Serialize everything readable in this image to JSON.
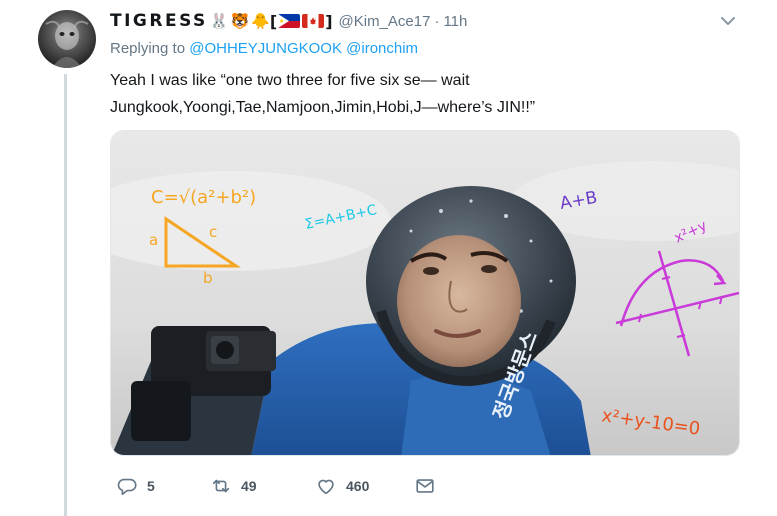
{
  "tweet": {
    "display_name": "TIGRESS",
    "emoji_1": "🐰",
    "emoji_2": "🐯",
    "emoji_3": "🐥",
    "bracket_open": "[",
    "bracket_close": "]",
    "flag_1": "philippines-flag",
    "flag_2": "canada-flag",
    "handle": "@Kim_Ace17",
    "separator": "·",
    "time": "11h",
    "replying_prefix": "Replying to",
    "reply_to_1": "@OHHEYJUNGKOOK",
    "reply_to_2": "@ironchim",
    "text_line_1": "Yeah I was like “one two three for five six se— wait",
    "text_line_2": "Jungkook,Yoongi,Tae,Namjoon,Jimin,Hobi,J—where’s JIN!!”"
  },
  "media": {
    "formula_1": "C=√(a²+b²)",
    "formula_2": "Σ=A+B+C",
    "formula_3": "A+B",
    "formula_4": "x²+y",
    "formula_5": "x²+y-10=0",
    "triangle_a": "a",
    "triangle_b": "b",
    "triangle_c": "c",
    "jacket_text": "정국방문스"
  },
  "actions": {
    "reply_count": "5",
    "retweet_count": "49",
    "like_count": "460"
  },
  "icons": {
    "reply": "reply-icon",
    "retweet": "retweet-icon",
    "like": "heart-icon",
    "dm": "envelope-icon",
    "menu": "chevron-down-icon"
  },
  "colors": {
    "link": "#1da1f2",
    "secondary_text": "#657786",
    "formula_orange": "#f5a623",
    "formula_cyan": "#1ec8e6",
    "formula_purple": "#6a3cc8",
    "formula_magenta": "#c93ad8",
    "formula_red": "#e8531e"
  }
}
